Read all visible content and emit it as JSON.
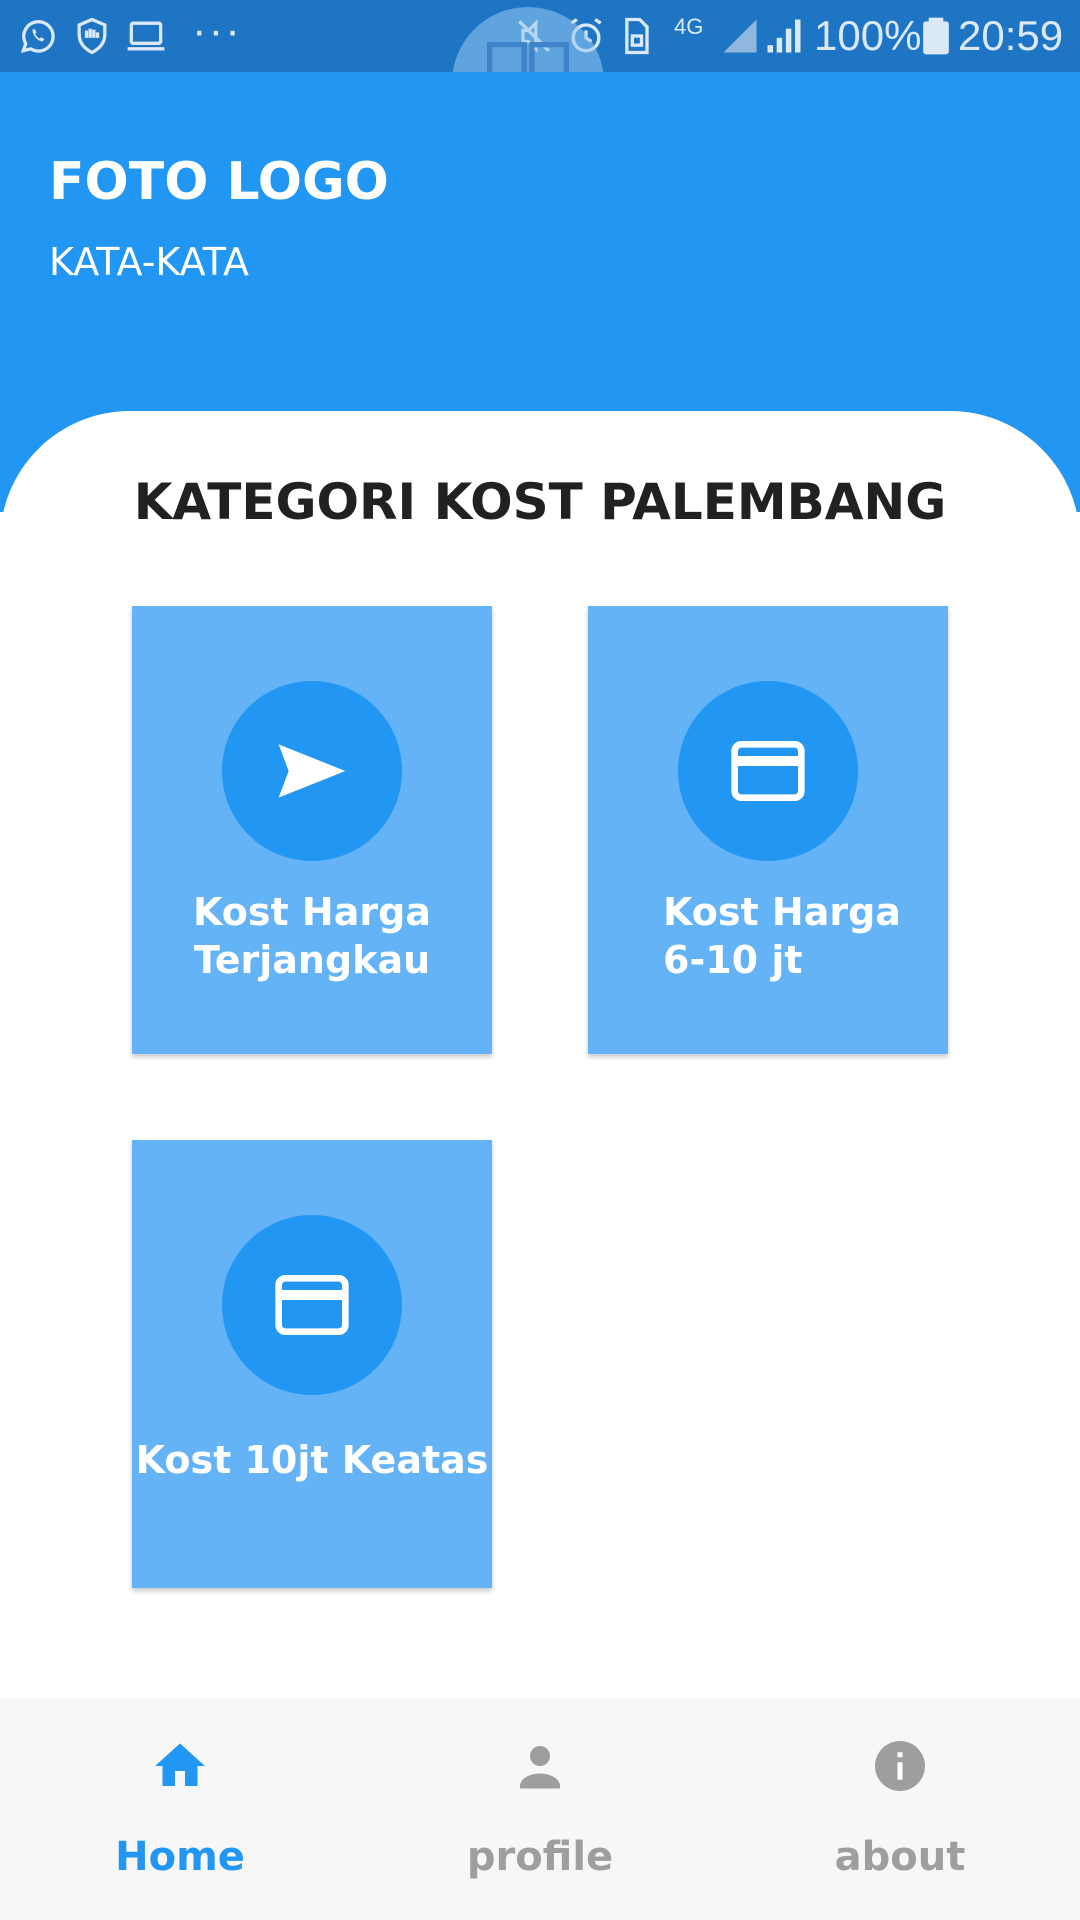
{
  "status_bar": {
    "battery": "100%",
    "time": "20:59",
    "network": "4G",
    "more": "···",
    "icons": [
      "whatsapp-icon",
      "shield-hand-icon",
      "laptop-icon",
      "mute-icon",
      "alarm-icon",
      "sim-icon",
      "signal-icon",
      "battery-icon"
    ]
  },
  "overlay": {
    "icon": "grid-icon"
  },
  "header": {
    "logo_text": "FOTO LOGO",
    "tagline": "KATA-KATA",
    "background": "#2196f3"
  },
  "main": {
    "section_title": "KATEGORI KOST PALEMBANG",
    "categories": [
      {
        "line1": "Kost Harga",
        "line2": "Terjangkau",
        "icon": "send-icon"
      },
      {
        "line1": "Kost Harga",
        "line2": "6-10 jt",
        "icon": "credit-card-icon"
      },
      {
        "line1": "Kost 10jt Keatas",
        "line2": "",
        "icon": "credit-card-icon"
      }
    ],
    "tile_color": "#64b3f6",
    "circle_color": "#2196f3"
  },
  "bottom_nav": {
    "items": [
      {
        "label": "Home",
        "icon": "home-icon",
        "active": true
      },
      {
        "label": "profile",
        "icon": "person-icon",
        "active": false
      },
      {
        "label": "about",
        "icon": "info-icon",
        "active": false
      }
    ],
    "active_color": "#2196f3",
    "inactive_color": "#9e9e9e"
  }
}
